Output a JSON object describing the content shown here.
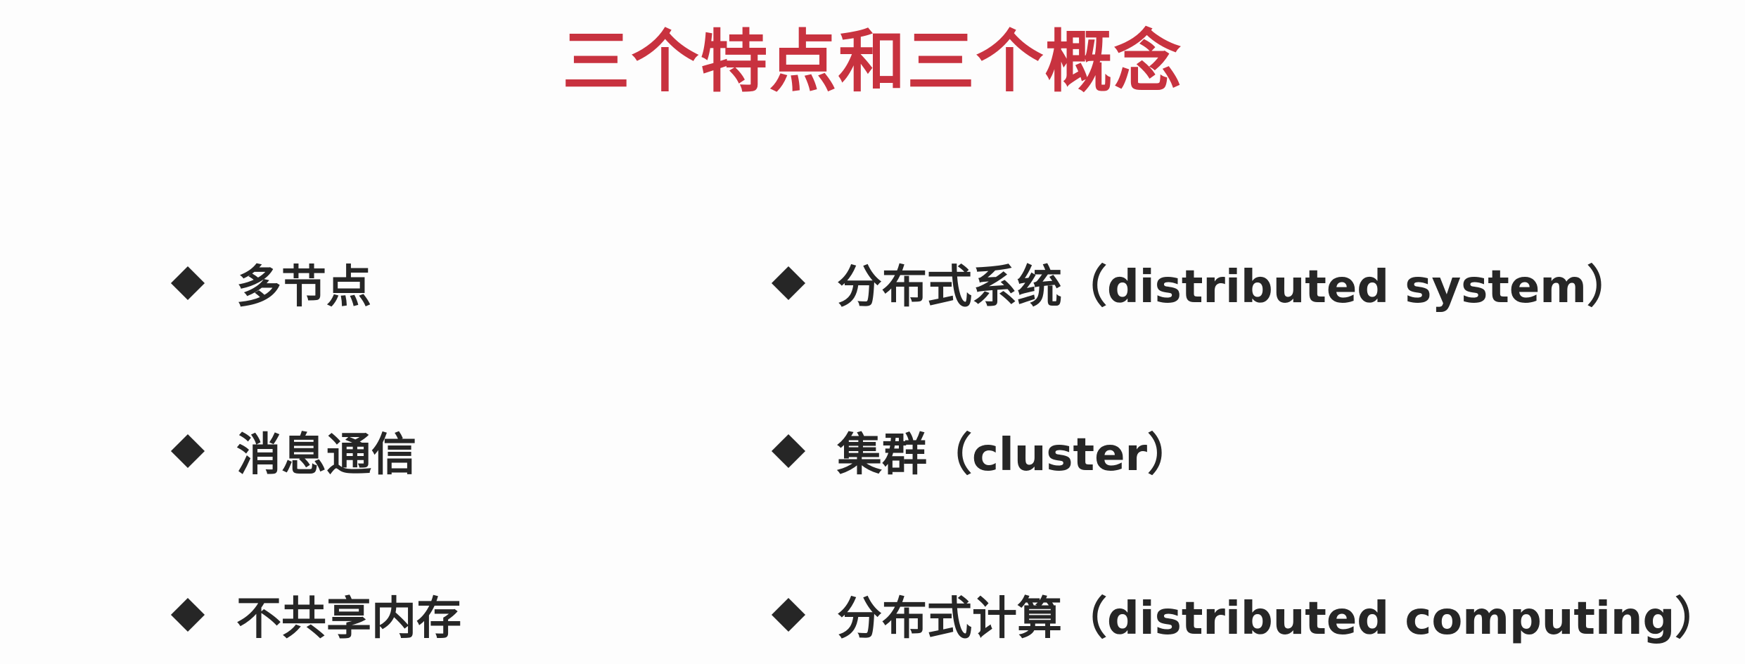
{
  "title": "三个特点和三个概念",
  "features": [
    {
      "label": "多节点"
    },
    {
      "label": "消息通信"
    },
    {
      "label": "不共享内存"
    }
  ],
  "concepts": [
    {
      "label": "分布式系统（distributed system）"
    },
    {
      "label": "集群（cluster）"
    },
    {
      "label": "分布式计算（distributed computing）"
    }
  ],
  "colors": {
    "title": "#c8323f",
    "text": "#262626",
    "background": "#fdfdfd"
  },
  "icons": {
    "bullet": "diamond-bullet-icon"
  }
}
